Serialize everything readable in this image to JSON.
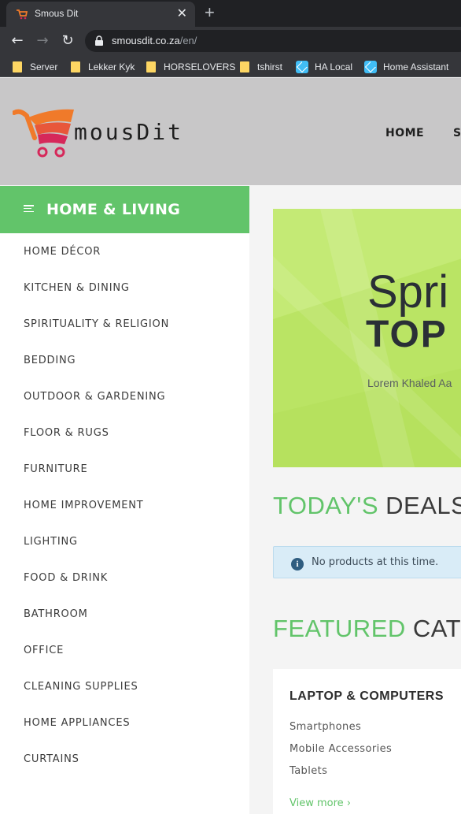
{
  "browser": {
    "tab_title": "Smous Dit",
    "tab_close": "✕",
    "new_tab": "+",
    "url_host": "smousdit.co.za",
    "url_path": "/en/",
    "bookmarks": [
      {
        "label": "Server",
        "icon": "folder-icon"
      },
      {
        "label": "Lekker Kyk",
        "icon": "folder-icon"
      },
      {
        "label": "HORSELOVERS",
        "icon": "folder-icon"
      },
      {
        "label": "tshirst",
        "icon": "folder-icon"
      },
      {
        "label": "HA Local",
        "icon": "home-assistant-icon"
      },
      {
        "label": "Home Assistant",
        "icon": "home-assistant-icon"
      }
    ]
  },
  "header": {
    "logo_text": "mousDit",
    "nav": [
      "HOME",
      "S"
    ]
  },
  "sidebar": {
    "title": "HOME & LIVING",
    "items": [
      "HOME DÉCOR",
      "KITCHEN & DINING",
      "SPIRITUALITY & RELIGION",
      "BEDDING",
      "OUTDOOR & GARDENING",
      "FLOOR & RUGS",
      "FURNITURE",
      "HOME IMPROVEMENT",
      "LIGHTING",
      "FOOD & DRINK",
      "BATHROOM",
      "OFFICE",
      "CLEANING SUPPLIES",
      "HOME APPLIANCES",
      "CURTAINS"
    ]
  },
  "hero": {
    "line1": "Spri",
    "line2": "TOP",
    "subtitle": "Lorem Khaled Aa"
  },
  "deals": {
    "title_green": "TODAY'S",
    "title_dark": "DEALS",
    "empty_message": "No products at this time.",
    "info_icon_glyph": "i"
  },
  "featured": {
    "title_green": "FEATURED",
    "title_dark": "CATE",
    "card": {
      "title": "LAPTOP & COMPUTERS",
      "links": [
        "Smartphones",
        "Mobile Accessories",
        "Tablets"
      ],
      "view_more": "View more ›"
    }
  },
  "colors": {
    "brand_green": "#62c46a",
    "header_bg": "#c8c7c8",
    "hero_bg": "#bfe76b",
    "logo_orange": "#f07a2a",
    "logo_pink": "#d6285a"
  }
}
